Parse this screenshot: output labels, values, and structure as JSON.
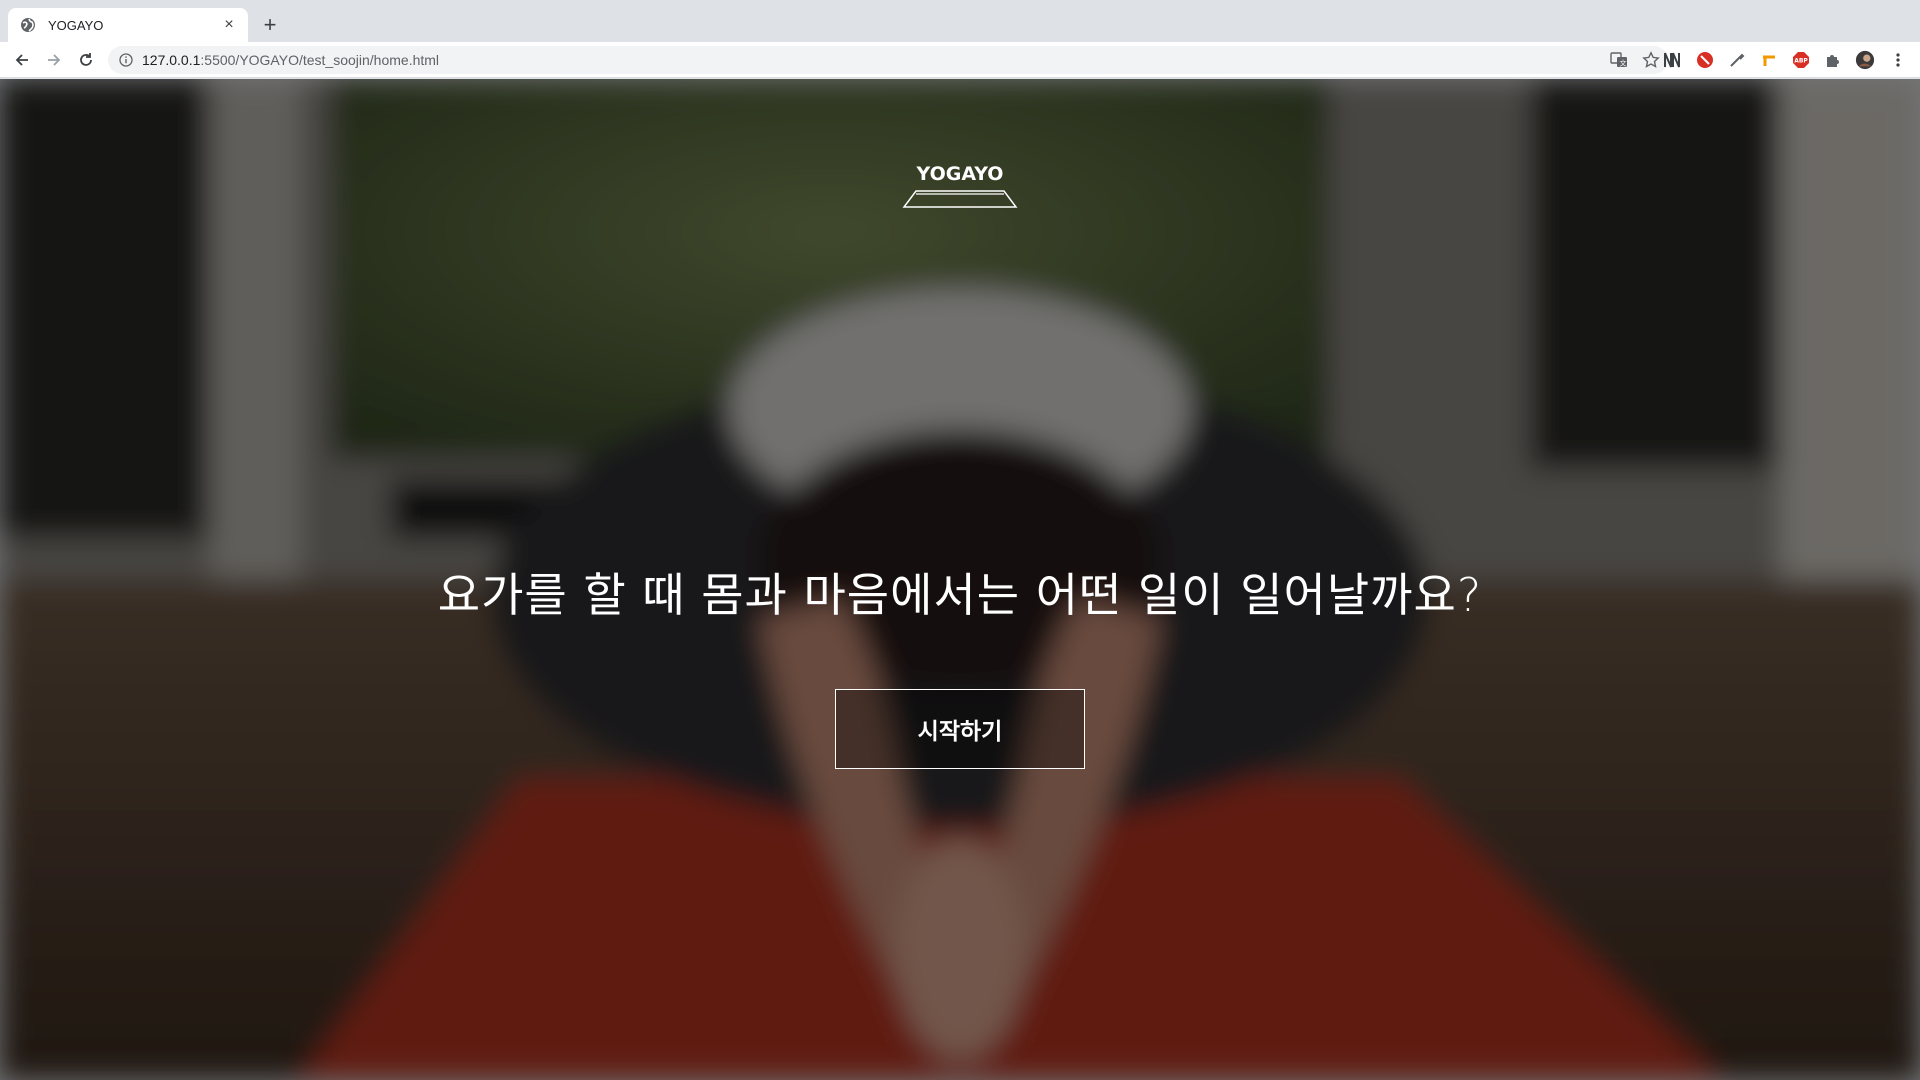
{
  "browser": {
    "tab_title": "YOGAYO",
    "tab_close": "×",
    "new_tab": "+",
    "url_host": "127.0.0.1",
    "url_rest": ":5500/YOGAYO/test_soojin/home.html"
  },
  "hero": {
    "logo_text": "YOGAYO",
    "headline": "요가를 할 때 몸과 마음에서는 어떤 일이 일어날까요?",
    "start_button": "시작하기"
  },
  "colors": {
    "chrome_bg": "#dee1e6",
    "toolbar_bg": "#ffffff",
    "omnibox_bg": "#f1f3f4",
    "mat_red": "#b83524",
    "text_white": "#ffffff"
  },
  "icons": [
    "globe-icon",
    "close-icon",
    "plus-icon",
    "back-arrow-icon",
    "forward-arrow-icon",
    "reload-icon",
    "info-icon",
    "translate-icon",
    "star-icon",
    "extension-icons",
    "puzzle-icon",
    "avatar",
    "kebab-menu-icon"
  ]
}
